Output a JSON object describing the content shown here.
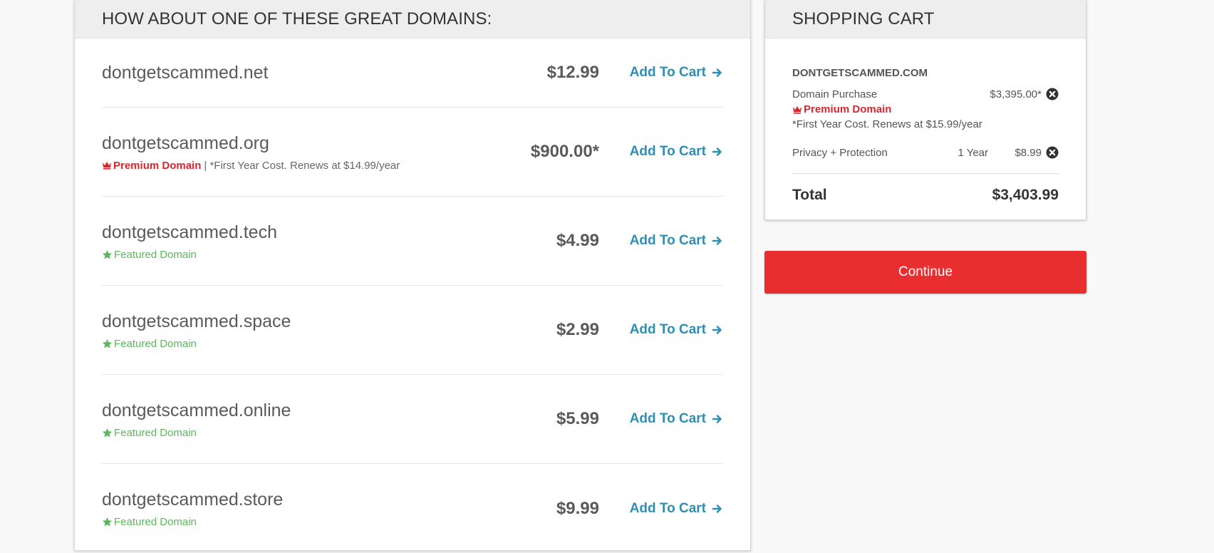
{
  "suggestions": {
    "title": "HOW ABOUT ONE OF THESE GREAT DOMAINS:",
    "add_label": "Add To Cart",
    "items": [
      {
        "name": "dontgetscammed.net",
        "price": "$12.99",
        "badge": "none"
      },
      {
        "name": "dontgetscammed.org",
        "price": "$900.00*",
        "badge": "premium",
        "badge_label": "Premium Domain",
        "note": "| *First Year Cost. Renews at $14.99/year"
      },
      {
        "name": "dontgetscammed.tech",
        "price": "$4.99",
        "badge": "featured",
        "badge_label": "Featured Domain"
      },
      {
        "name": "dontgetscammed.space",
        "price": "$2.99",
        "badge": "featured",
        "badge_label": "Featured Domain"
      },
      {
        "name": "dontgetscammed.online",
        "price": "$5.99",
        "badge": "featured",
        "badge_label": "Featured Domain"
      },
      {
        "name": "dontgetscammed.store",
        "price": "$9.99",
        "badge": "featured",
        "badge_label": "Featured Domain"
      }
    ]
  },
  "cart": {
    "title": "SHOPPING CART",
    "domain": "DONTGETSCAMMED.COM",
    "purchase_label": "Domain Purchase",
    "purchase_price": "$3,395.00*",
    "premium_label": "Premium Domain",
    "renew_note": "*First Year Cost. Renews at $15.99/year",
    "privacy_label": "Privacy + Protection",
    "privacy_term": "1 Year",
    "privacy_price": "$8.99",
    "total_label": "Total",
    "total_value": "$3,403.99",
    "continue_label": "Continue"
  },
  "icons": {
    "premium": "crown-icon",
    "featured": "star-icon",
    "add": "arrow-right-circle-icon",
    "remove": "close-circle-icon"
  },
  "colors": {
    "premium": "#d9262e",
    "featured": "#5cb85c",
    "link": "#2e8fb3",
    "continue": "#e82e2e"
  }
}
